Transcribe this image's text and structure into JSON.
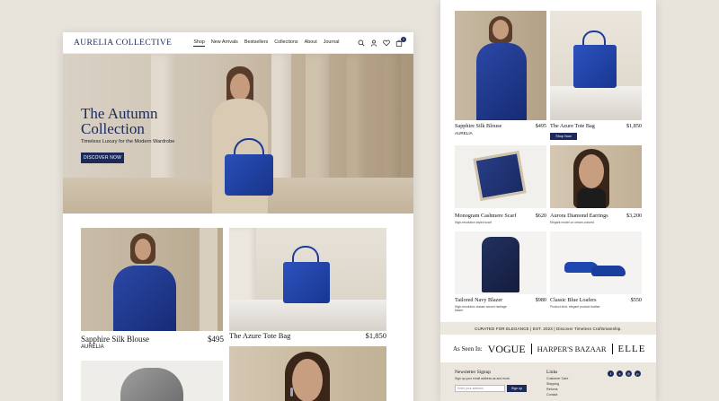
{
  "desktop": {
    "brand": "AURELIA COLLECTIVE",
    "nav": [
      "Shop",
      "New Arrivals",
      "Bestsellers",
      "Collections",
      "About",
      "Journal"
    ],
    "cart_count": "1",
    "hero": {
      "title": "The Autumn Collection",
      "subtitle": "Timeless Luxury for the Modern Wardrobe",
      "cta": "DISCOVER NOW"
    },
    "products": [
      {
        "name": "Sapphire Silk Blouse",
        "price": "$495",
        "brand": "AURELIA"
      },
      {
        "name": "The Azure Tote Bag",
        "price": "$1,850"
      }
    ]
  },
  "mobile": {
    "products": [
      {
        "name": "Sapphire Silk Blouse",
        "price": "$495",
        "brand": "AURELIA"
      },
      {
        "name": "The Azure Tote Bag",
        "price": "$1,850",
        "cta": "Shop Now"
      },
      {
        "name": "Monogram Cashmere Scarf",
        "price": "$620",
        "desc": "High-resolution styled scarf"
      },
      {
        "name": "Aurora Diamond Earrings",
        "price": "$3,200",
        "desc": "Elegant model on cream-colored"
      },
      {
        "name": "Tailored Navy Blazer",
        "price": "$980",
        "desc": "High-resolution classic woven heritage blazer"
      },
      {
        "name": "Classic Blue Loafers",
        "price": "$550",
        "desc": "Product shot, elegant product leather"
      }
    ],
    "strip": "CURATED FOR ELEGANCE  |  EST. 2023  |  Discover Timeless Craftsmanship.",
    "as_seen": {
      "label": "As Seen In:",
      "mags": [
        "VOGUE",
        "HARPER'S BAZAAR",
        "ELLE"
      ]
    },
    "footer": {
      "newsletter_title": "Newsletter Signup",
      "newsletter_sub": "Sign up your email address as and more.",
      "email_placeholder": "Enter your address",
      "signup": "Sign up",
      "links_title": "Links",
      "links": [
        "Customer Care",
        "Shipping",
        "Returns",
        "Contact"
      ]
    }
  },
  "colors": {
    "navy": "#1b2a5b",
    "cobalt": "#1f3f9e",
    "cream": "#ece8de"
  }
}
